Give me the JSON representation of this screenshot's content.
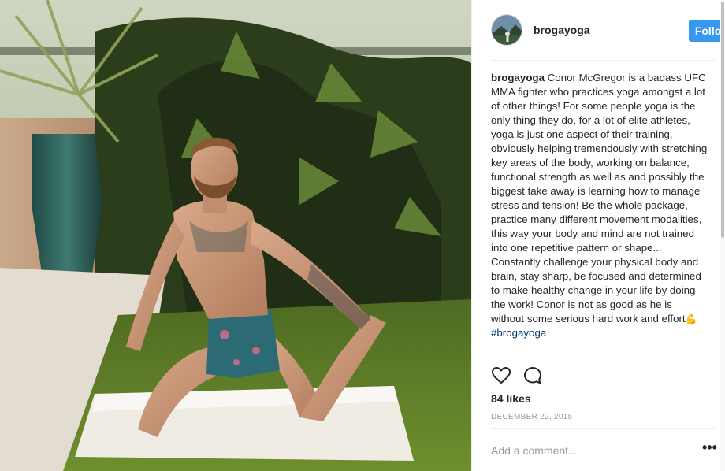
{
  "post": {
    "username": "brogayoga",
    "follow_label": "Follow",
    "caption": {
      "user": "brogayoga",
      "text": " Conor McGregor is a badass UFC MMA fighter who practices yoga amongst a lot of other things! For some people yoga is the only thing they do, for a lot of elite athletes, yoga is just one aspect of their training, obviously helping tremendously with stretching key areas of the body, working on balance, functional strength as well as and possibly the biggest take away is learning how to manage stress and tension! Be the whole package, practice many different movement modalities, this way your body and mind are not trained into one repetitive pattern or shape... Constantly challenge your physical body and brain, stay sharp, be focused and determined to make healthy change in your life by doing the work! Conor is not as good as he is without some serious hard work and effort",
      "emoji": "💪",
      "hashtag": "#brogayoga"
    },
    "likes": "84 likes",
    "date": "December 22, 2015",
    "comment_placeholder": "Add a comment...",
    "more_label": "•••"
  },
  "icons": {
    "like": "heart-icon",
    "comment": "comment-bubble-icon",
    "more": "more-options-icon"
  },
  "colors": {
    "accent": "#3897f0",
    "hashtag": "#003569",
    "muted": "#999999",
    "text": "#262626"
  }
}
